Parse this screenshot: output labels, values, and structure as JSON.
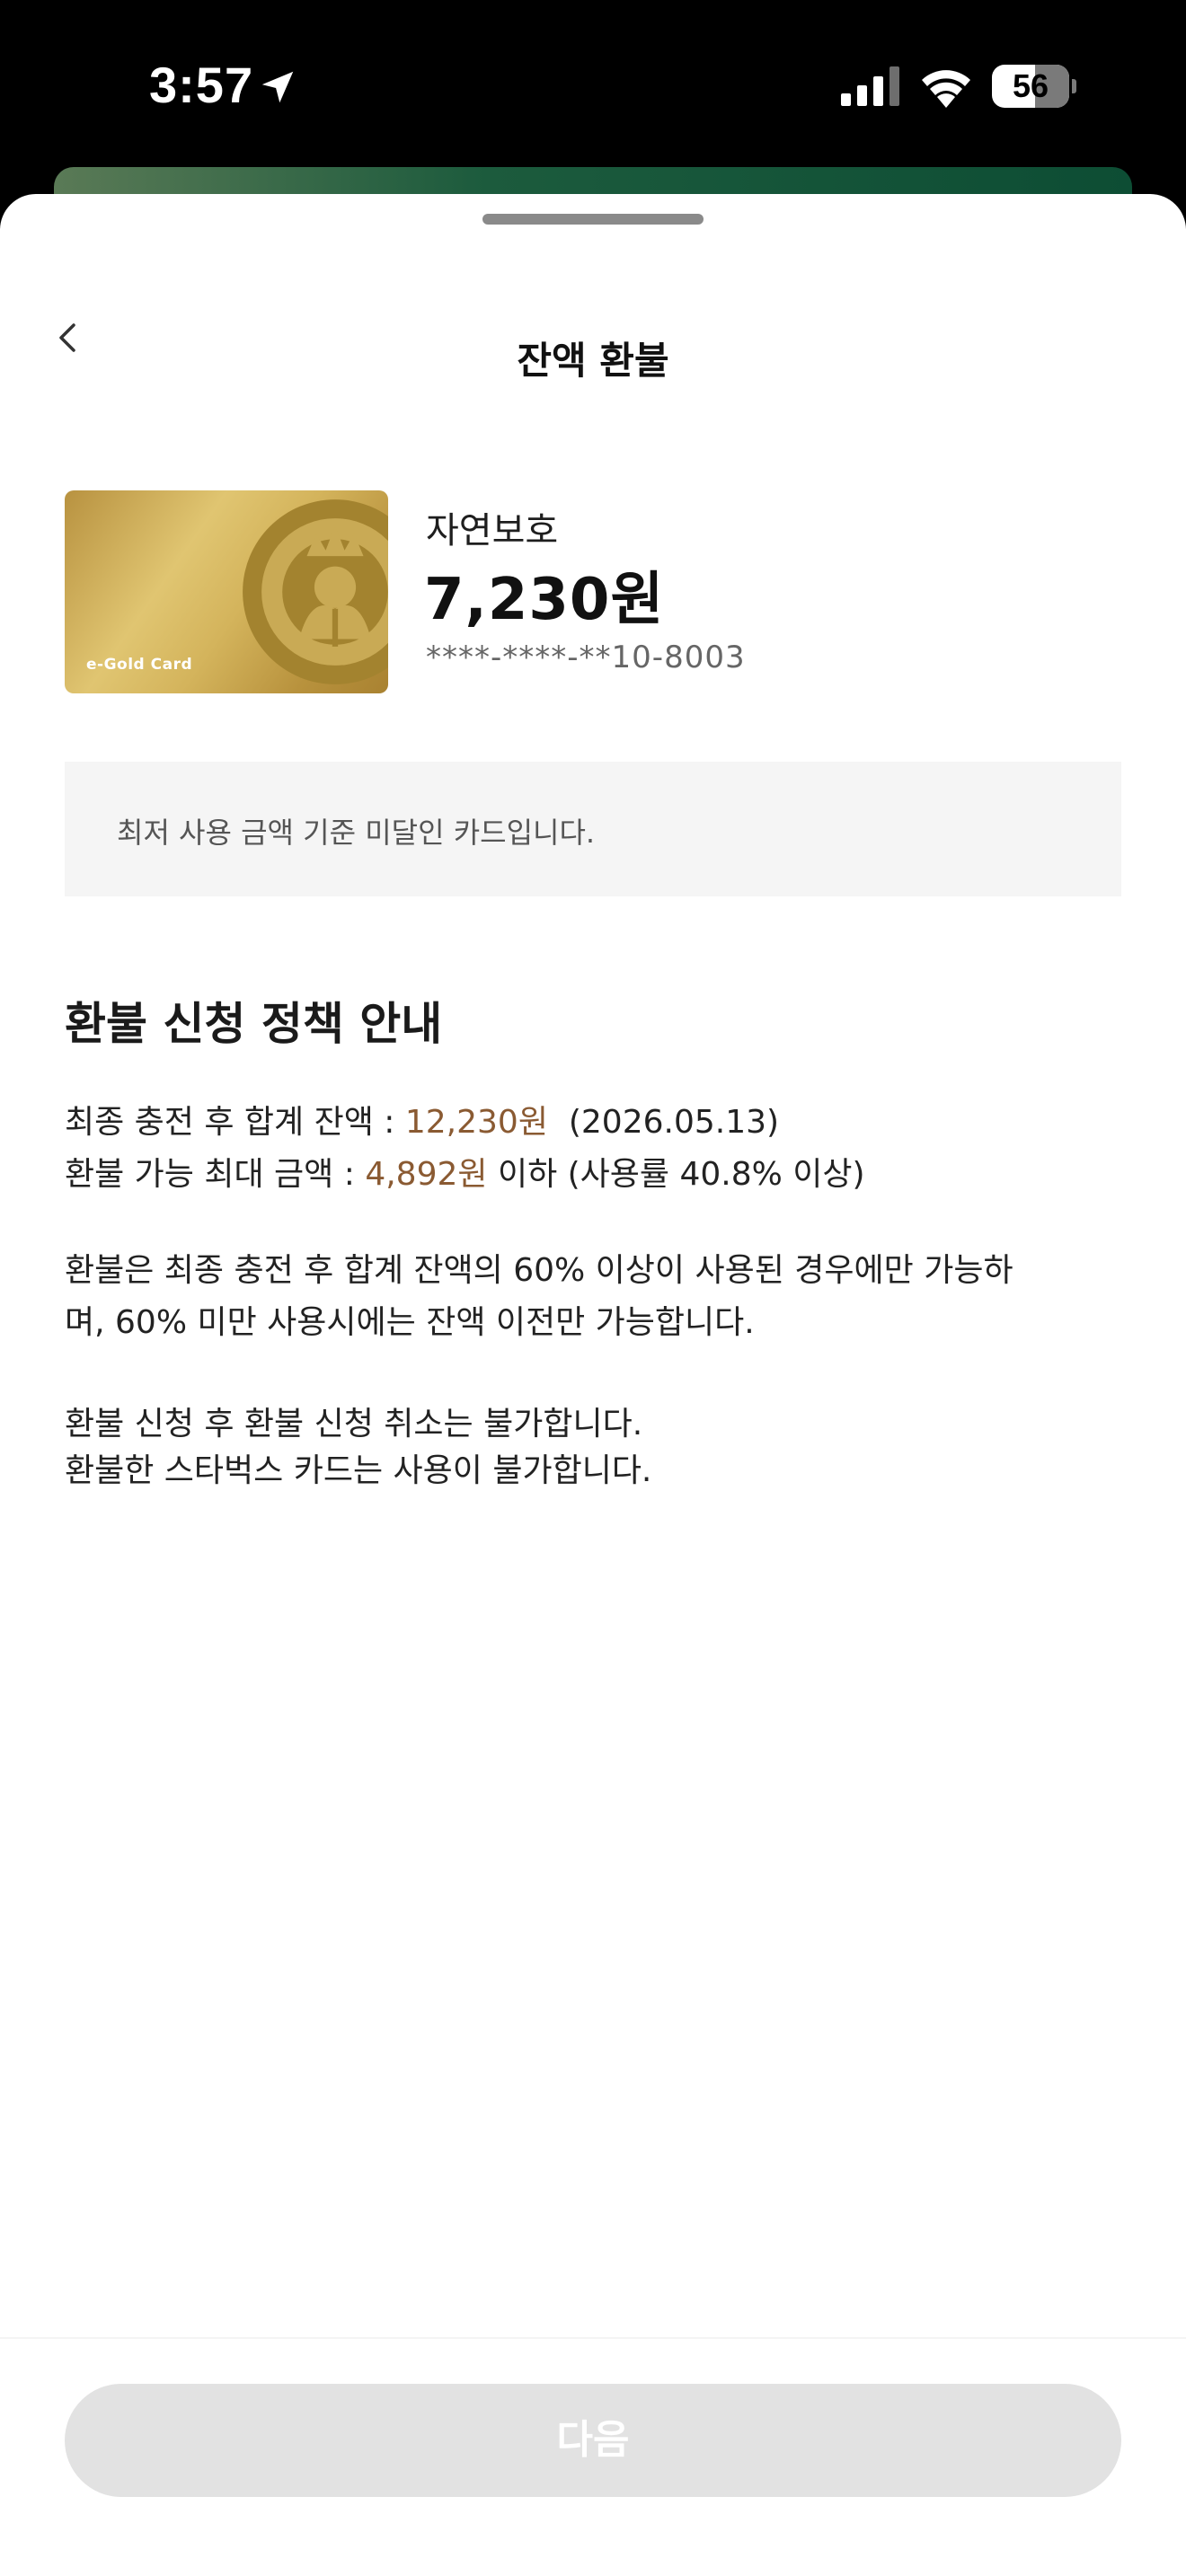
{
  "status_bar": {
    "time": "3:57",
    "battery_level": "56",
    "battery_fraction": 0.56
  },
  "header": {
    "title": "잔액 환불",
    "back_icon": "chevron-left-icon"
  },
  "card": {
    "image_label": "e-Gold Card",
    "name": "자연보호",
    "balance": "7,230원",
    "number": "****-****-**10-8003"
  },
  "notice": {
    "text": "최저 사용 금액 기준 미달인 카드입니다."
  },
  "policy": {
    "heading": "환불 신청 정책 안내",
    "total_label": "최종 충전 후 합계 잔액 : ",
    "total_amount": "12,230원",
    "total_date": "(2026.05.13)",
    "max_label": "환불 가능 최대 금액 : ",
    "max_amount": "4,892원",
    "max_suffix": " 이하 (사용률 40.8% 이상)",
    "paragraph_line1": "환불은 최종 충전 후 합계 잔액의 60% 이상이 사용된 경우에만 가능하",
    "paragraph_line2": "며, 60% 미만 사용시에는 잔액 이전만 가능합니다.",
    "note1": "환불 신청 후 환불 신청 취소는 불가합니다.",
    "note2": "환불한 스타벅스 카드는 사용이 불가합니다."
  },
  "footer": {
    "next_label": "다음"
  },
  "colors": {
    "highlight": "#8a5a32",
    "button_disabled": "#e2e2e2",
    "notice_bg": "#f5f5f5"
  }
}
